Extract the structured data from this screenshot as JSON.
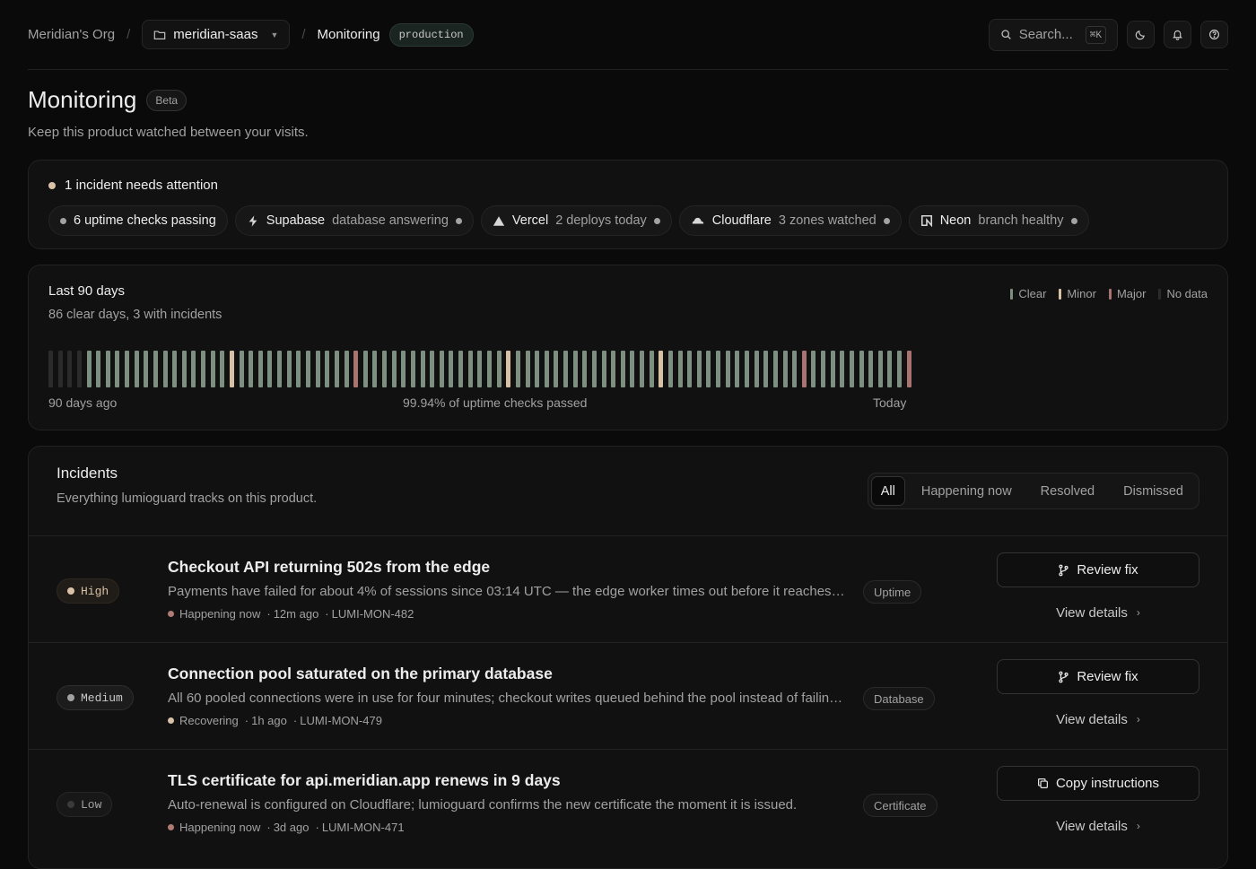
{
  "breadcrumb": {
    "org": "Meridian's Org",
    "project": "meridian-saas",
    "page": "Monitoring",
    "environment": "production"
  },
  "topbar": {
    "search_label": "Search...",
    "search_shortcut": "⌘K",
    "icons": [
      "moon-icon",
      "bell-icon",
      "help-icon"
    ]
  },
  "header": {
    "title": "Monitoring",
    "badge": "Beta",
    "subtitle": "Keep this product watched between your visits."
  },
  "status": {
    "attention": "1 incident needs attention",
    "attention_color": "#d9c2a7",
    "pills": [
      {
        "icon": "dot",
        "name": "6 uptime checks passing",
        "detail": ""
      },
      {
        "icon": "bolt-icon",
        "name": "Supabase",
        "detail": "database answering"
      },
      {
        "icon": "triangle-icon",
        "name": "Vercel",
        "detail": "2 deploys today"
      },
      {
        "icon": "cloud-icon",
        "name": "Cloudflare",
        "detail": "3 zones watched"
      },
      {
        "icon": "neon-icon",
        "name": "Neon",
        "detail": "branch healthy"
      }
    ]
  },
  "uptime": {
    "title": "Last 90 days",
    "summary": "86 clear days, 3 with incidents",
    "legend": [
      {
        "label": "Clear",
        "color": "#7c8f80"
      },
      {
        "label": "Minor",
        "color": "#d6c1a5"
      },
      {
        "label": "Major",
        "color": "#a9736f"
      },
      {
        "label": "No data",
        "color": "#2b2b2b"
      }
    ],
    "start_label": "90 days ago",
    "center_label": "99.94% of uptime checks passed",
    "end_label": "Today",
    "days": [
      "n",
      "n",
      "n",
      "n",
      "c",
      "c",
      "c",
      "c",
      "c",
      "c",
      "c",
      "c",
      "c",
      "c",
      "c",
      "c",
      "c",
      "c",
      "c",
      "m",
      "c",
      "c",
      "c",
      "c",
      "c",
      "c",
      "c",
      "c",
      "c",
      "c",
      "c",
      "c",
      "M",
      "c",
      "c",
      "c",
      "c",
      "c",
      "c",
      "c",
      "c",
      "c",
      "c",
      "c",
      "c",
      "c",
      "c",
      "c",
      "m",
      "c",
      "c",
      "c",
      "c",
      "c",
      "c",
      "c",
      "c",
      "c",
      "c",
      "c",
      "c",
      "c",
      "c",
      "c",
      "m",
      "c",
      "c",
      "c",
      "c",
      "c",
      "c",
      "c",
      "c",
      "c",
      "c",
      "c",
      "c",
      "c",
      "c",
      "M",
      "c",
      "c",
      "c",
      "c",
      "c",
      "c",
      "c",
      "c",
      "c",
      "c",
      "M"
    ]
  },
  "incidents": {
    "title": "Incidents",
    "subtitle": "Everything lumioguard tracks on this product.",
    "tabs": [
      "All",
      "Happening now",
      "Resolved",
      "Dismissed"
    ],
    "active_tab": "All",
    "details_label": "View details",
    "items": [
      {
        "severity": "High",
        "severity_color": "#d9c2a7",
        "title": "Checkout API returning 502s from the edge",
        "description": "Payments have failed for about 4% of sessions since 03:14 UTC — the edge worker times out before it reaches the origin.",
        "status": "Happening now",
        "status_color": "#b07b74",
        "age": "12m ago",
        "ref": "LUMI-MON-482",
        "tag": "Uptime",
        "action": "Review fix",
        "action_icon": "git-branch-icon"
      },
      {
        "severity": "Medium",
        "severity_color": "#a1a1a1",
        "title": "Connection pool saturated on the primary database",
        "description": "All 60 pooled connections were in use for four minutes; checkout writes queued behind the pool instead of failing fast.",
        "status": "Recovering",
        "status_color": "#d9c2a7",
        "age": "1h ago",
        "ref": "LUMI-MON-479",
        "tag": "Database",
        "action": "Review fix",
        "action_icon": "git-branch-icon"
      },
      {
        "severity": "Low",
        "severity_color": "#3a3a3a",
        "title": "TLS certificate for api.meridian.app renews in 9 days",
        "description": "Auto-renewal is configured on Cloudflare; lumioguard confirms the new certificate the moment it is issued.",
        "status": "Happening now",
        "status_color": "#b07b74",
        "age": "3d ago",
        "ref": "LUMI-MON-471",
        "tag": "Certificate",
        "action": "Copy instructions",
        "action_icon": "copy-icon"
      }
    ]
  }
}
